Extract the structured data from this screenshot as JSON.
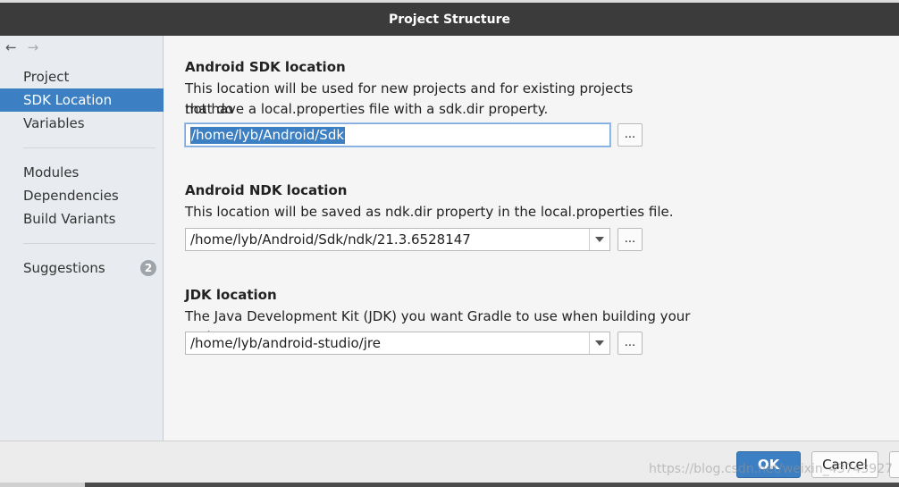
{
  "window": {
    "title": "Project Structure"
  },
  "nav": {
    "back_icon": "←",
    "forward_icon": "→"
  },
  "sidebar": {
    "group1": [
      {
        "label": "Project",
        "selected": false
      },
      {
        "label": "SDK Location",
        "selected": true
      },
      {
        "label": "Variables",
        "selected": false
      }
    ],
    "group2": [
      {
        "label": "Modules"
      },
      {
        "label": "Dependencies"
      },
      {
        "label": "Build Variants"
      }
    ],
    "suggestions": {
      "label": "Suggestions",
      "count": "2"
    }
  },
  "sdk": {
    "title": "Android SDK location",
    "desc_line1": "This location will be used for new projects and for existing projects that do",
    "desc_line2": "not have a local.properties file with a sdk.dir property.",
    "value": "/home/lyb/Android/Sdk",
    "browse": "..."
  },
  "ndk": {
    "title": "Android NDK location",
    "desc": "This location will be saved as ndk.dir property in the local.properties file.",
    "value": "/home/lyb/Android/Sdk/ndk/21.3.6528147",
    "browse": "..."
  },
  "jdk": {
    "title": "JDK location",
    "desc": "The Java Development Kit (JDK) you want Gradle to use when building your project.",
    "help": "?",
    "value": "/home/lyb/android-studio/jre",
    "browse": "..."
  },
  "footer": {
    "ok": "OK",
    "cancel": "Cancel"
  },
  "watermark": "https://blog.csdn.net/weixin_43743927",
  "colors": {
    "accent": "#3c7fc2",
    "titlebar": "#3b3b3b",
    "sidebar_bg": "#e8ecf0"
  }
}
